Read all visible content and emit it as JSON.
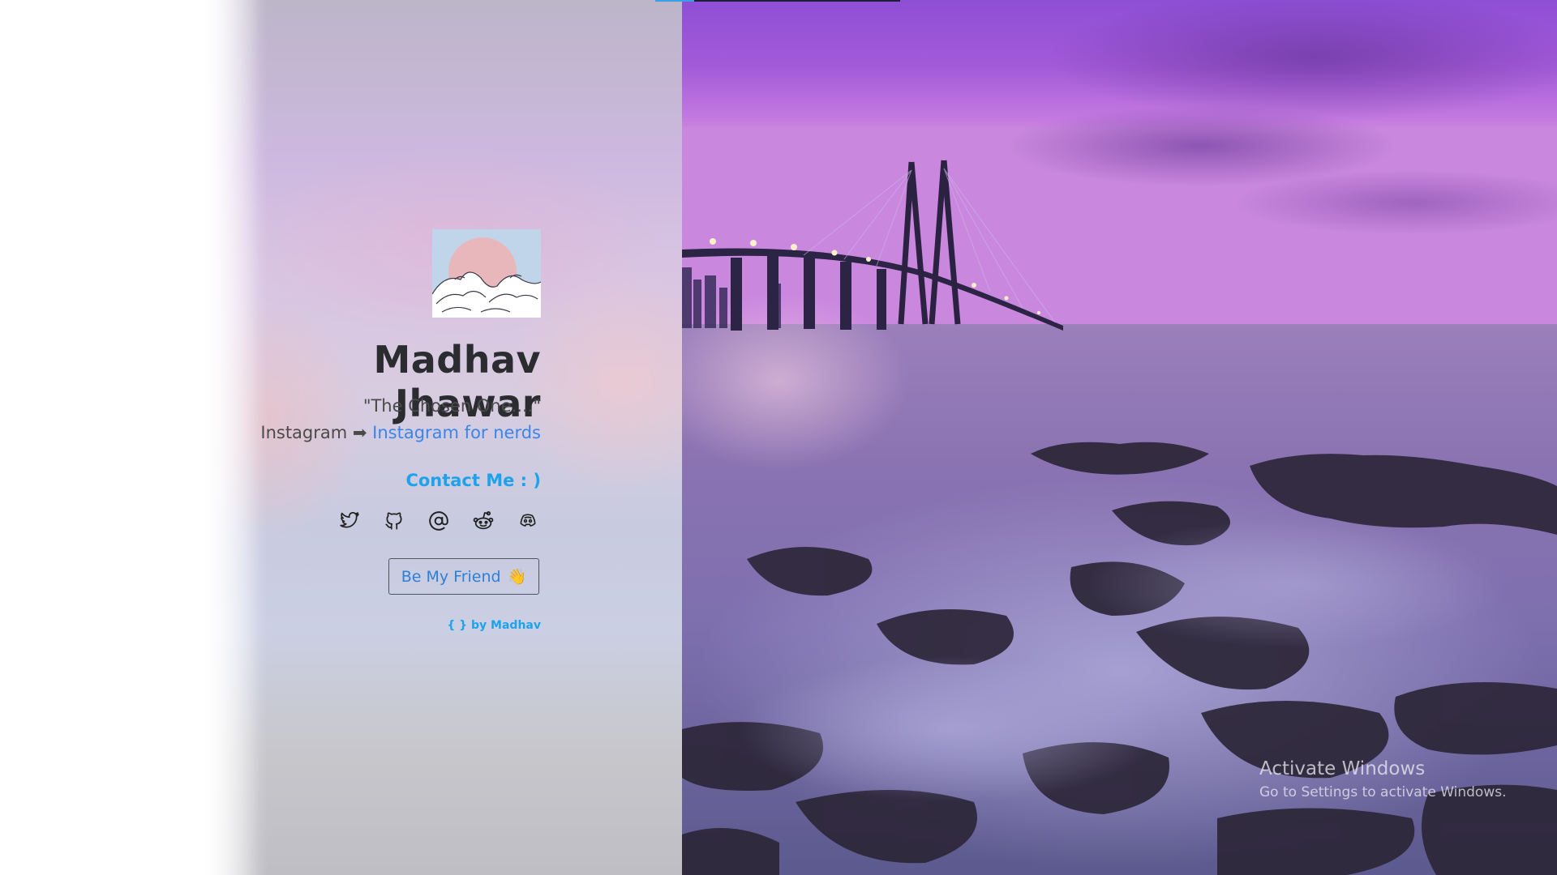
{
  "progress": {
    "fraction": 0.16
  },
  "profile": {
    "name": "Madhav  Jhawar",
    "tagline": "\"The Chosen One....\"",
    "instagram_prefix": "Instagram ➡ ",
    "instagram_link": "Instagram for nerds",
    "contact_heading": "Contact Me : )",
    "friend_button": "Be My Friend",
    "friend_emoji": "👋",
    "footer": "{ } by Madhav"
  },
  "socials": [
    {
      "icon": "twitter-icon"
    },
    {
      "icon": "github-icon"
    },
    {
      "icon": "at-sign-icon"
    },
    {
      "icon": "reddit-icon"
    },
    {
      "icon": "discord-icon"
    }
  ],
  "watermark": {
    "title": "Activate Windows",
    "subtitle": "Go to Settings to activate Windows."
  },
  "colors": {
    "accent_blue": "#1fa2ec",
    "link_blue": "#3a86e8",
    "name_text": "#2a2c30",
    "sky_purple": "#9a55d8"
  }
}
